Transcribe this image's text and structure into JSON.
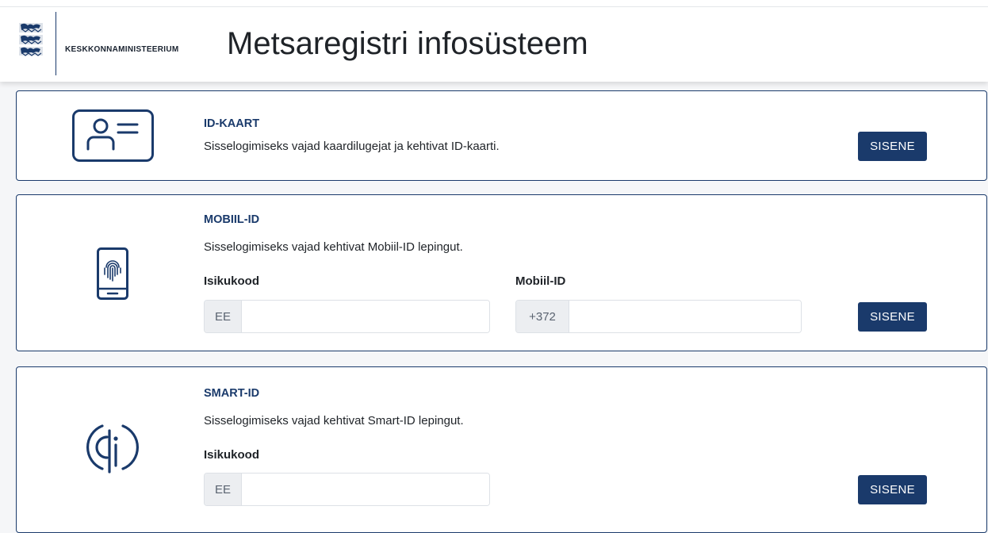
{
  "header": {
    "ministry": "Keskkonnaministeerium",
    "title": "Metsaregistri infosüsteem"
  },
  "id_card": {
    "title": "ID-KAART",
    "description": "Sisselogimiseks vajad kaardilugejat ja kehtivat ID-kaarti.",
    "button": "SISENE",
    "icon": "id-card-icon"
  },
  "mobile_id": {
    "title": "MOBIIL-ID",
    "description": "Sisselogimiseks vajad kehtivat Mobiil-ID lepingut.",
    "personal_code_label": "Isikukood",
    "personal_code_prefix": "EE",
    "personal_code_value": "",
    "phone_label": "Mobiil-ID",
    "phone_prefix": "+372",
    "phone_value": "",
    "button": "SISENE",
    "icon": "mobile-fingerprint-icon"
  },
  "smart_id": {
    "title": "SMART-ID",
    "description": "Sisselogimiseks vajad kehtivat Smart-ID lepingut.",
    "personal_code_label": "Isikukood",
    "personal_code_prefix": "EE",
    "personal_code_value": "",
    "button": "SISENE",
    "icon": "smart-id-icon"
  },
  "colors": {
    "primary": "#1a3a6b",
    "background": "#f5f6f8"
  }
}
